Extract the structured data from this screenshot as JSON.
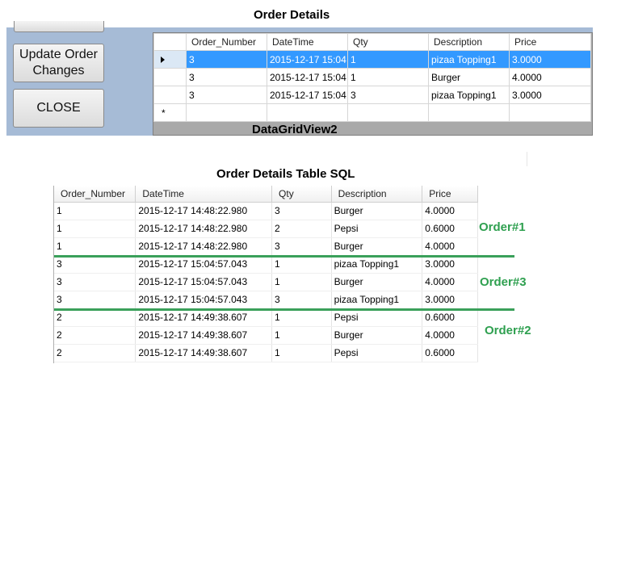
{
  "window": {
    "title": "Order Details"
  },
  "form": {
    "update_button": "Update Order Changes",
    "close_button": "CLOSE",
    "grid_label": "DataGridView2"
  },
  "grid": {
    "columns": [
      "Order_Number",
      "DateTime",
      "Qty",
      "Description",
      "Price"
    ],
    "rows": [
      [
        "3",
        "2015-12-17 15:04",
        "1",
        "pizaa  Topping1",
        "3.0000"
      ],
      [
        "3",
        "2015-12-17 15:04",
        "1",
        "Burger",
        "4.0000"
      ],
      [
        "3",
        "2015-12-17 15:04",
        "3",
        "pizaa  Topping1",
        "3.0000"
      ]
    ],
    "selected_row": 0,
    "new_row_marker": "*"
  },
  "sql_table": {
    "title": "Order Details Table SQL",
    "columns": [
      "Order_Number",
      "DateTime",
      "Qty",
      "Description",
      "Price"
    ],
    "rows": [
      [
        "1",
        "2015-12-17 14:48:22.980",
        "3",
        "Burger",
        "4.0000"
      ],
      [
        "1",
        "2015-12-17 14:48:22.980",
        "2",
        "Pepsi",
        "0.6000"
      ],
      [
        "1",
        "2015-12-17 14:48:22.980",
        "3",
        "Burger",
        "4.0000"
      ],
      [
        "3",
        "2015-12-17 15:04:57.043",
        "1",
        "pizaa  Topping1",
        "3.0000"
      ],
      [
        "3",
        "2015-12-17 15:04:57.043",
        "1",
        "Burger",
        "4.0000"
      ],
      [
        "3",
        "2015-12-17 15:04:57.043",
        "3",
        "pizaa  Topping1",
        "3.0000"
      ],
      [
        "2",
        "2015-12-17 14:49:38.607",
        "1",
        "Pepsi",
        "0.6000"
      ],
      [
        "2",
        "2015-12-17 14:49:38.607",
        "1",
        "Burger",
        "4.0000"
      ],
      [
        "2",
        "2015-12-17 14:49:38.607",
        "1",
        "Pepsi",
        "0.6000"
      ]
    ]
  },
  "annotations": {
    "order1": "Order#1",
    "order3": "Order#3",
    "order2": "Order#2",
    "color": "#2fa050"
  },
  "colors": {
    "form_background": "#a6bbd6",
    "selection": "#3399ff"
  }
}
